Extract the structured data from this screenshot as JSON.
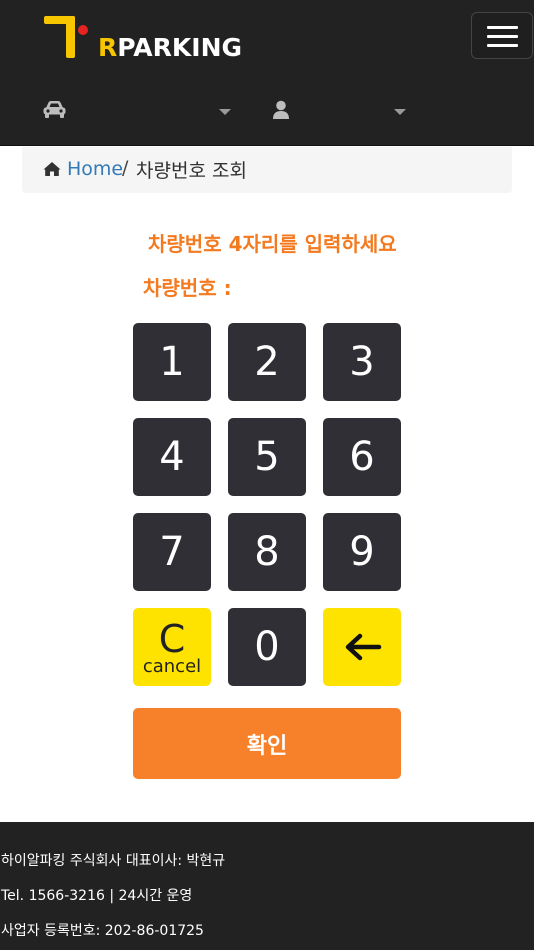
{
  "header": {
    "logo_text": "RPARKING",
    "logo_text_first": "R",
    "logo_text_rest": "PARKING",
    "brand_color": "#f7c600",
    "accent_red": "#e52421"
  },
  "nav": {
    "car_icon": "car-icon",
    "user_icon": "user-icon"
  },
  "breadcrumb": {
    "home_label": "Home",
    "separator": "/",
    "current": "차량번호 조회"
  },
  "main": {
    "instruction": "차량번호 4자리를 입력하세요",
    "plate_label": "차량번호 :",
    "plate_value": "",
    "keypad": {
      "k1": "1",
      "k2": "2",
      "k3": "3",
      "k4": "4",
      "k5": "5",
      "k6": "6",
      "k7": "7",
      "k8": "8",
      "k9": "9",
      "clear_big": "C",
      "clear_small": "cancel",
      "k0": "0",
      "backspace_icon": "arrow-left-icon"
    },
    "confirm_label": "확인",
    "accent_color": "#f47a20"
  },
  "footer": {
    "company": "하이알파킹 주식회사 대표이사: 박현규",
    "tel": "Tel. 1566-3216 | 24시간 운영",
    "business_no": "사업자 등록번호: 202-86-01725"
  }
}
